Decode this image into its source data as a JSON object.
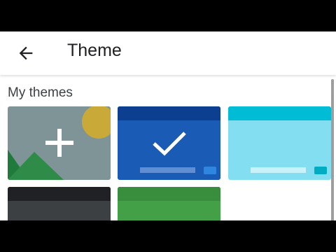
{
  "header": {
    "title": "Theme",
    "back_icon": "arrow-back-icon"
  },
  "section": {
    "title": "My themes"
  },
  "themes": [
    {
      "kind": "add-custom",
      "icon": "add-icon",
      "colors": {
        "bg": "#7e9497",
        "sun": "#c9a938",
        "mountain_light": "#2e8b48",
        "mountain_dark": "#1f7a3c"
      }
    },
    {
      "kind": "color",
      "selected": true,
      "icon": "checkmark-icon",
      "colors": {
        "header": "#0d3f91",
        "body": "#1a5bb5",
        "bar": "#5f8fd2",
        "key": "#2f86e0"
      }
    },
    {
      "kind": "color",
      "selected": false,
      "colors": {
        "header": "#00bcd4",
        "body": "#82def0",
        "bar": "#c9f2fa",
        "key": "#00acc1"
      }
    },
    {
      "kind": "color",
      "selected": false,
      "colors": {
        "header": "#202124",
        "body": "#3c4043"
      }
    },
    {
      "kind": "color",
      "selected": false,
      "colors": {
        "header": "#388e3c",
        "body": "#43a047"
      }
    }
  ]
}
